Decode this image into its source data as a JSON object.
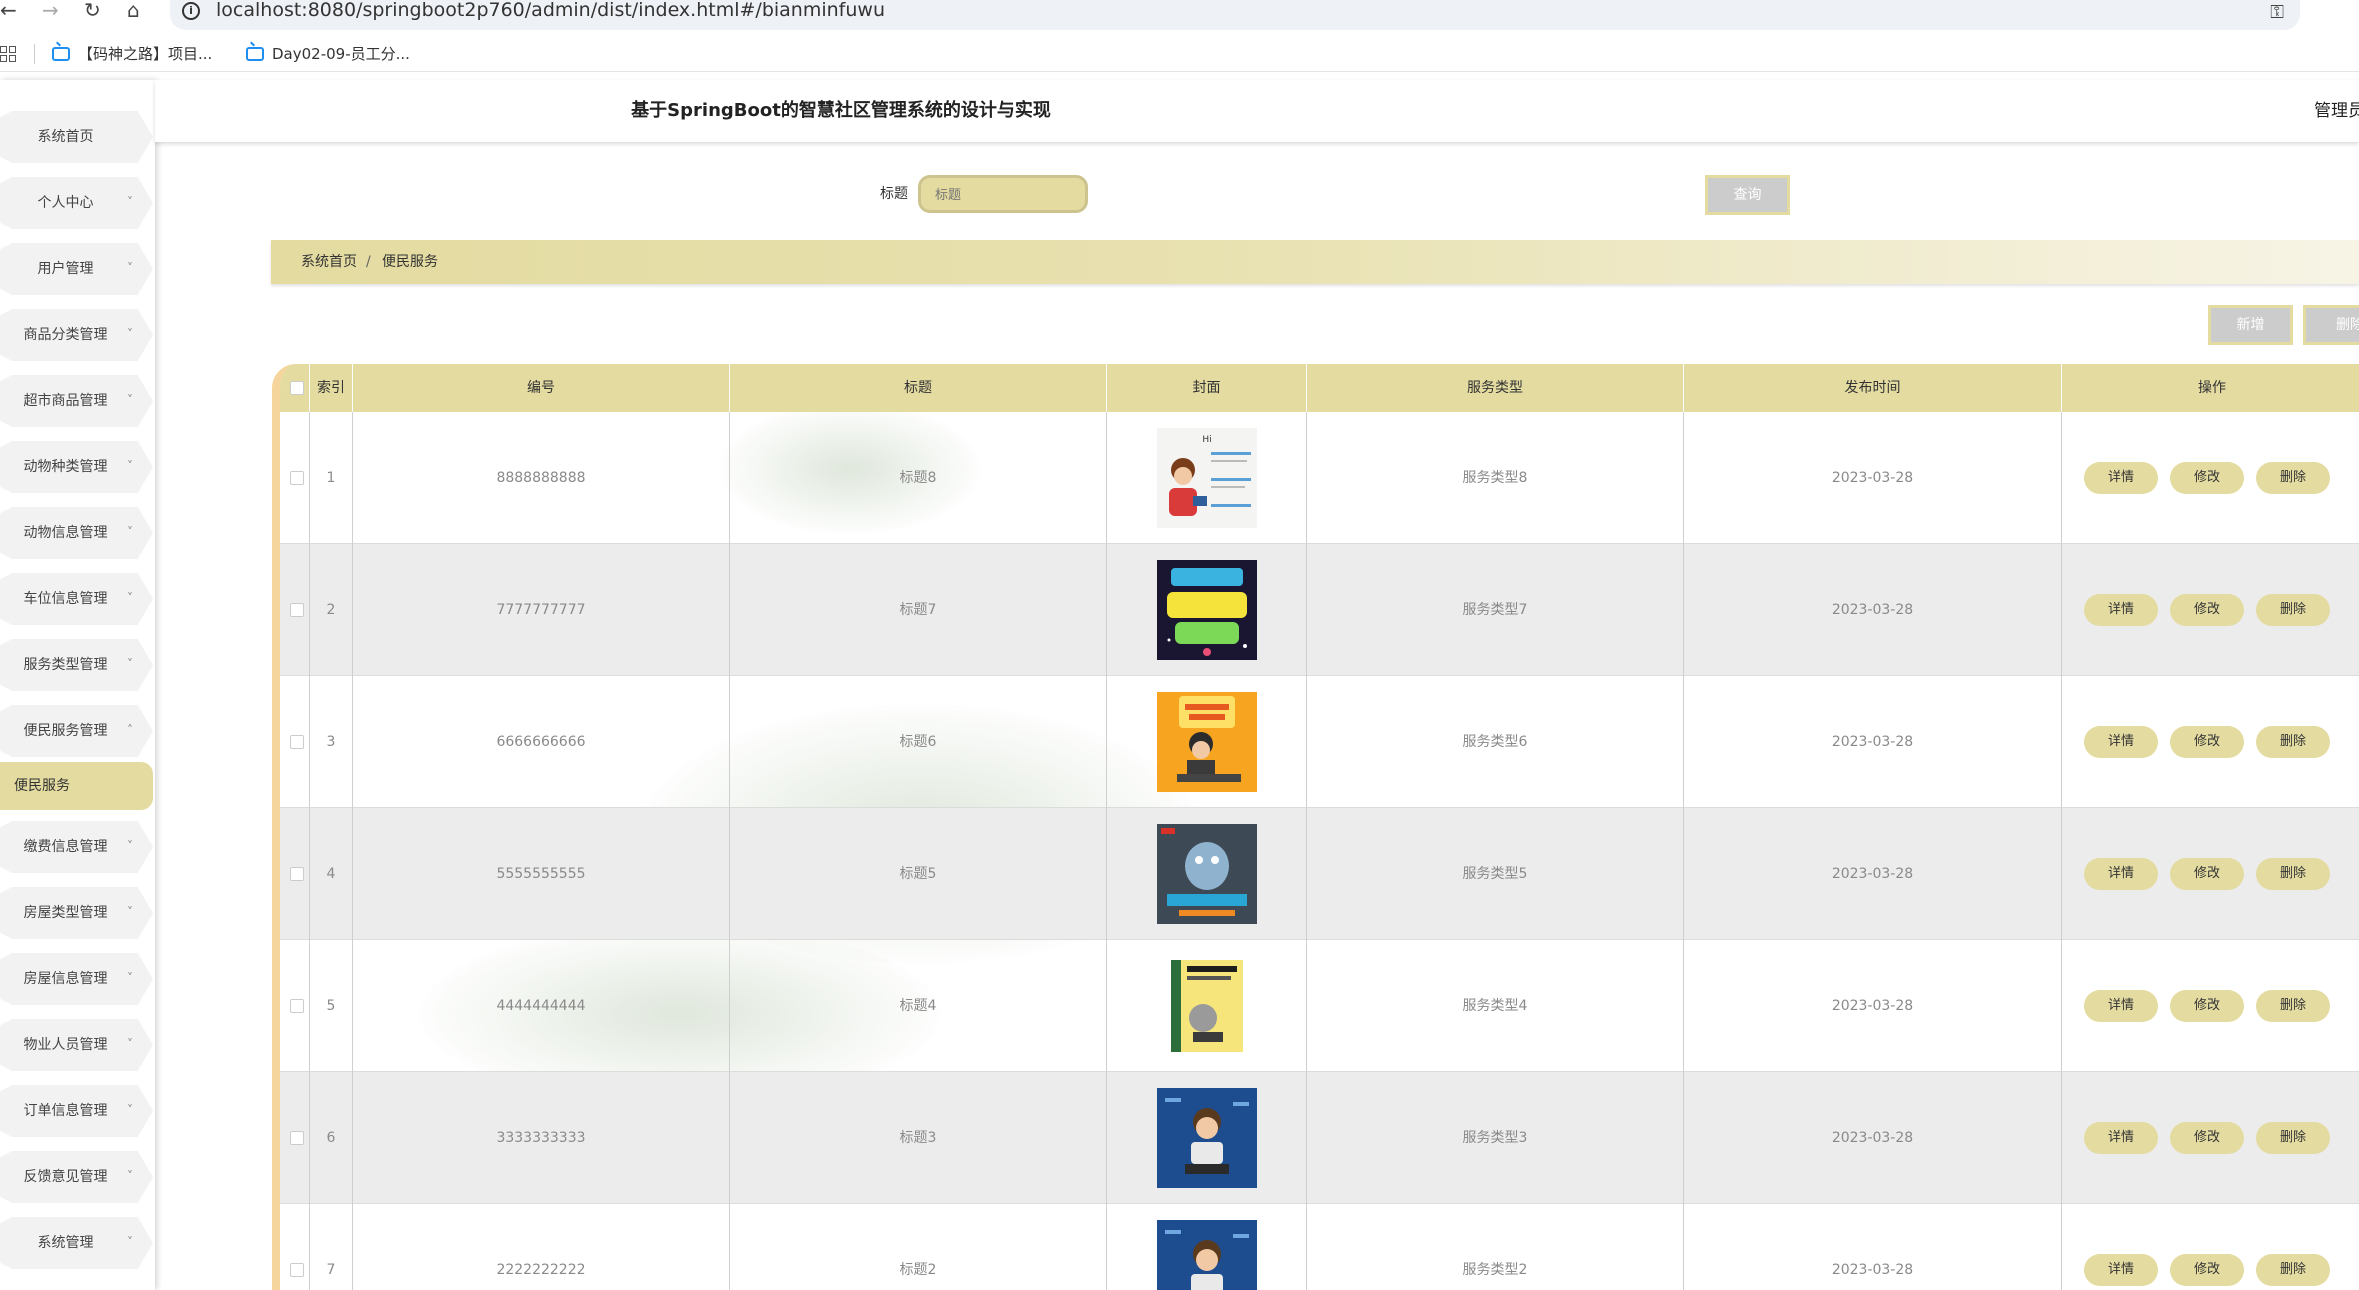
{
  "browser": {
    "url": "localhost:8080/springboot2p760/admin/dist/index.html#/bianminfuwu",
    "bookmarks": [
      "【码神之路】项目...",
      "Day02-09-员工分..."
    ]
  },
  "header": {
    "title": "基于SpringBoot的智慧社区管理系统的设计与实现",
    "admin_text": "管理员"
  },
  "sidebar": {
    "items": [
      {
        "label": "系统首页",
        "chevron": ""
      },
      {
        "label": "个人中心",
        "chevron": "˅"
      },
      {
        "label": "用户管理",
        "chevron": "˅"
      },
      {
        "label": "商品分类管理",
        "chevron": "˅"
      },
      {
        "label": "超市商品管理",
        "chevron": "˅"
      },
      {
        "label": "动物种类管理",
        "chevron": "˅"
      },
      {
        "label": "动物信息管理",
        "chevron": "˅"
      },
      {
        "label": "车位信息管理",
        "chevron": "˅"
      },
      {
        "label": "服务类型管理",
        "chevron": "˅"
      },
      {
        "label": "便民服务管理",
        "chevron": "˄"
      },
      {
        "label": "缴费信息管理",
        "chevron": "˅"
      },
      {
        "label": "房屋类型管理",
        "chevron": "˅"
      },
      {
        "label": "房屋信息管理",
        "chevron": "˅"
      },
      {
        "label": "物业人员管理",
        "chevron": "˅"
      },
      {
        "label": "订单信息管理",
        "chevron": "˅"
      },
      {
        "label": "反馈意见管理",
        "chevron": "˅"
      },
      {
        "label": "系统管理",
        "chevron": "˅"
      }
    ],
    "active_sub": "便民服务"
  },
  "search": {
    "label": "标题",
    "placeholder": "标题",
    "query_label": "查询"
  },
  "breadcrumb": {
    "home": "系统首页",
    "separator": "/",
    "current": "便民服务"
  },
  "actions": {
    "add_label": "新增",
    "delete_label": "删除"
  },
  "table": {
    "headers": [
      "索引",
      "编号",
      "标题",
      "封面",
      "服务类型",
      "发布时间",
      "操作"
    ],
    "rows": [
      {
        "index": "1",
        "code": "8888888888",
        "title": "标题8",
        "service_type": "服务类型8",
        "date": "2023-03-28"
      },
      {
        "index": "2",
        "code": "7777777777",
        "title": "标题7",
        "service_type": "服务类型7",
        "date": "2023-03-28"
      },
      {
        "index": "3",
        "code": "6666666666",
        "title": "标题6",
        "service_type": "服务类型6",
        "date": "2023-03-28"
      },
      {
        "index": "4",
        "code": "5555555555",
        "title": "标题5",
        "service_type": "服务类型5",
        "date": "2023-03-28"
      },
      {
        "index": "5",
        "code": "4444444444",
        "title": "标题4",
        "service_type": "服务类型4",
        "date": "2023-03-28"
      },
      {
        "index": "6",
        "code": "3333333333",
        "title": "标题3",
        "service_type": "服务类型3",
        "date": "2023-03-28"
      },
      {
        "index": "7",
        "code": "2222222222",
        "title": "标题2",
        "service_type": "服务类型2",
        "date": "2023-03-28"
      }
    ],
    "row_actions": {
      "detail": "详情",
      "edit": "修改",
      "delete": "删除"
    }
  },
  "colors": {
    "accent": "#e3dba0",
    "accent_border": "#f6d59c",
    "button_gray": "#cccccc"
  }
}
